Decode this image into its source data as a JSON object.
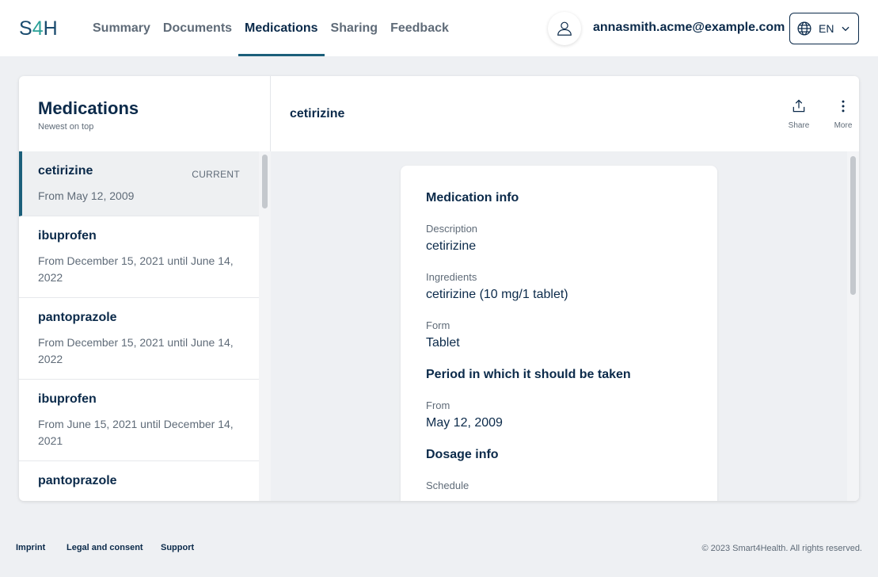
{
  "header": {
    "logo_s": "S",
    "logo_4": "4",
    "logo_h": "H",
    "nav": [
      {
        "label": "Summary"
      },
      {
        "label": "Documents"
      },
      {
        "label": "Medications"
      },
      {
        "label": "Sharing"
      },
      {
        "label": "Feedback"
      }
    ],
    "active_nav": "Medications",
    "user_email": "annasmith.acme@example.com",
    "language": "EN"
  },
  "sidebar": {
    "title": "Medications",
    "subtitle": "Newest on top",
    "items": [
      {
        "name": "cetirizine",
        "badge": "CURRENT",
        "date": "From May 12, 2009"
      },
      {
        "name": "ibuprofen",
        "badge": "",
        "date": "From December 15, 2021 until June 14, 2022"
      },
      {
        "name": "pantoprazole",
        "badge": "",
        "date": "From December 15, 2021 until June 14, 2022"
      },
      {
        "name": "ibuprofen",
        "badge": "",
        "date": "From June 15, 2021 until December 14, 2021"
      },
      {
        "name": "pantoprazole",
        "badge": "",
        "date": ""
      }
    ]
  },
  "detail": {
    "title": "cetirizine",
    "share_label": "Share",
    "more_label": "More",
    "sections": {
      "medication_info": "Medication info",
      "period": "Period in which it should be taken",
      "dosage": "Dosage info"
    },
    "fields": {
      "description_label": "Description",
      "description_value": "cetirizine",
      "ingredients_label": "Ingredients",
      "ingredients_value": "cetirizine (10 mg/1 tablet)",
      "form_label": "Form",
      "form_value": "Tablet",
      "from_label": "From",
      "from_value": "May 12, 2009",
      "schedule_label": "Schedule"
    }
  },
  "footer": {
    "imprint": "Imprint",
    "legal": "Legal and consent",
    "support": "Support",
    "copyright": "© 2023 Smart4Health. All rights reserved."
  },
  "colors": {
    "primary": "#0b2a4a",
    "accent": "#1b5f7a",
    "logo_accent": "#2aa198",
    "muted": "#5f6b78",
    "background": "#eef0f3"
  },
  "icons": {
    "avatar": "user-icon",
    "language": "globe-icon",
    "dropdown": "chevron-down-icon",
    "share": "share-icon",
    "more": "more-vertical-icon"
  }
}
